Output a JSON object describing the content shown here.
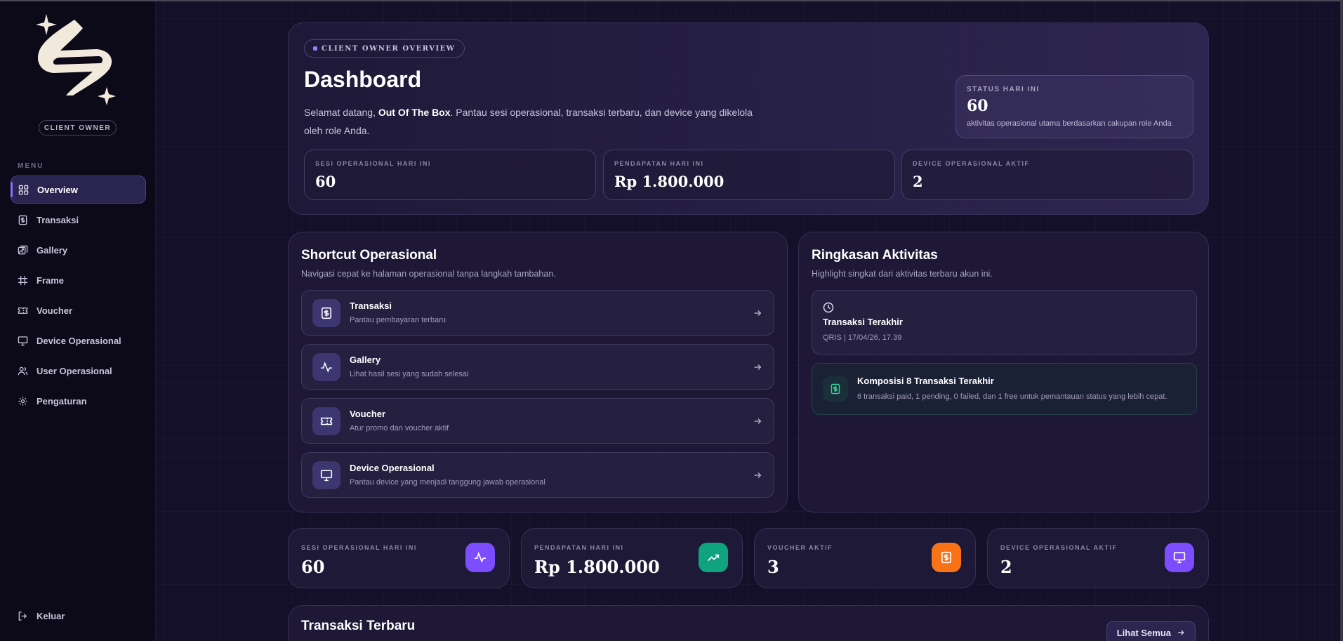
{
  "sidebar": {
    "role_badge": "CLIENT OWNER",
    "menu_label": "MENU",
    "items": [
      {
        "label": "Overview",
        "icon": "grid-icon",
        "active": true
      },
      {
        "label": "Transaksi",
        "icon": "dollar-receipt-icon",
        "active": false
      },
      {
        "label": "Gallery",
        "icon": "image-gallery-icon",
        "active": false
      },
      {
        "label": "Frame",
        "icon": "frame-icon",
        "active": false
      },
      {
        "label": "Voucher",
        "icon": "ticket-icon",
        "active": false
      },
      {
        "label": "Device Operasional",
        "icon": "monitor-icon",
        "active": false
      },
      {
        "label": "User Operasional",
        "icon": "users-icon",
        "active": false
      },
      {
        "label": "Pengaturan",
        "icon": "gear-icon",
        "active": false
      }
    ],
    "logout_label": "Keluar"
  },
  "hero": {
    "badge": "CLIENT OWNER OVERVIEW",
    "title": "Dashboard",
    "desc_prefix": "Selamat datang, ",
    "desc_name": "Out Of The Box",
    "desc_suffix": ". Pantau sesi operasional, transaksi terbaru, dan device yang dikelola oleh role Anda.",
    "status": {
      "label": "STATUS HARI INI",
      "value": "60",
      "desc": "aktivitas operasional utama berdasarkan cakupan role Anda"
    },
    "stats": [
      {
        "label": "SESI OPERASIONAL HARI INI",
        "value": "60"
      },
      {
        "label": "PENDAPATAN HARI INI",
        "value": "Rp 1.800.000"
      },
      {
        "label": "DEVICE OPERASIONAL AKTIF",
        "value": "2"
      }
    ]
  },
  "shortcut": {
    "title": "Shortcut Operasional",
    "subtitle": "Navigasi cepat ke halaman operasional tanpa langkah tambahan.",
    "items": [
      {
        "title": "Transaksi",
        "desc": "Pantau pembayaran terbaru"
      },
      {
        "title": "Gallery",
        "desc": "Lihat hasil sesi yang sudah selesai"
      },
      {
        "title": "Voucher",
        "desc": "Atur promo dan voucher aktif"
      },
      {
        "title": "Device Operasional",
        "desc": "Pantau device yang menjadi tanggung jawab operasional"
      }
    ]
  },
  "summary": {
    "title": "Ringkasan Aktivitas",
    "subtitle": "Highlight singkat dari aktivitas terbaru akun ini.",
    "last_tx": {
      "title": "Transaksi Terakhir",
      "desc": "QRIS | 17/04/26, 17.39"
    },
    "composition": {
      "title": "Komposisi 8 Transaksi Terakhir",
      "desc": "6 transaksi paid, 1 pending, 0 failed, dan 1 free untuk pemantauan status yang lebih cepat."
    }
  },
  "kpis": [
    {
      "label": "SESI OPERASIONAL HARI INI",
      "value": "60",
      "icon": "activity-icon",
      "color": "#7c4dff"
    },
    {
      "label": "PENDAPATAN HARI INI",
      "value": "Rp 1.800.000",
      "icon": "trending-up-icon",
      "color": "#10a37f"
    },
    {
      "label": "VOUCHER AKTIF",
      "value": "3",
      "icon": "dollar-receipt-icon",
      "color": "#f97316"
    },
    {
      "label": "DEVICE OPERASIONAL AKTIF",
      "value": "2",
      "icon": "monitor-icon",
      "color": "#7c4dff"
    }
  ],
  "recent": {
    "title": "Transaksi Terbaru",
    "see_all": "Lihat Semua"
  }
}
